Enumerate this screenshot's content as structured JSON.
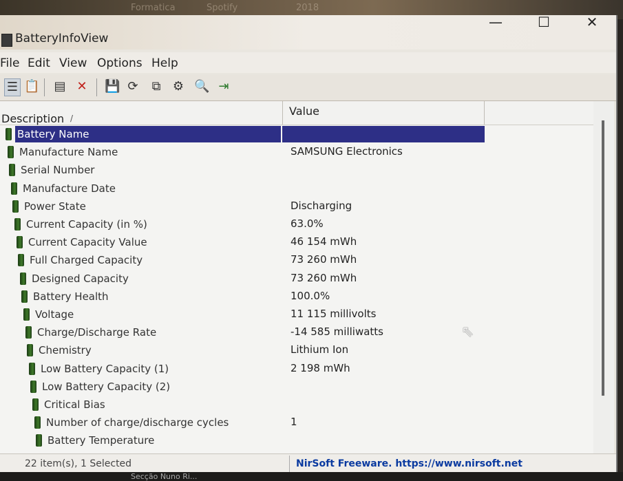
{
  "background": {
    "top_text": [
      "Formatica",
      "Spotify",
      "2018"
    ],
    "bottom_text": "Secção Nuno Ri..."
  },
  "window": {
    "title": "BatteryInfoView",
    "minimize": "—",
    "maximize": "☐",
    "close": "✕"
  },
  "menu": [
    "File",
    "Edit",
    "View",
    "Options",
    "Help"
  ],
  "toolbar": {
    "icons": [
      "properties-icon",
      "clipboard-icon",
      "html-report-icon",
      "delete-icon",
      "save-icon",
      "refresh-icon",
      "copy-icon",
      "options-icon",
      "find-icon",
      "exit-icon"
    ]
  },
  "table": {
    "col_description": "Description",
    "col_value": "Value",
    "sort_indicator": "/",
    "rows": [
      {
        "description": "Battery Name",
        "value": "",
        "selected": true
      },
      {
        "description": "Manufacture Name",
        "value": "SAMSUNG Electronics"
      },
      {
        "description": "Serial Number",
        "value": ""
      },
      {
        "description": "Manufacture Date",
        "value": ""
      },
      {
        "description": "Power State",
        "value": "Discharging"
      },
      {
        "description": "Current Capacity (in %)",
        "value": "63.0%"
      },
      {
        "description": "Current Capacity Value",
        "value": "46 154 mWh"
      },
      {
        "description": "Full Charged Capacity",
        "value": "73 260 mWh"
      },
      {
        "description": "Designed Capacity",
        "value": "73 260 mWh"
      },
      {
        "description": "Battery Health",
        "value": "100.0%"
      },
      {
        "description": "Voltage",
        "value": "11 115 millivolts"
      },
      {
        "description": "Charge/Discharge Rate",
        "value": "-14 585 milliwatts"
      },
      {
        "description": "Chemistry",
        "value": "Lithium Ion"
      },
      {
        "description": "Low Battery Capacity (1)",
        "value": "2 198 mWh"
      },
      {
        "description": "Low Battery Capacity (2)",
        "value": ""
      },
      {
        "description": "Critical Bias",
        "value": ""
      },
      {
        "description": "Number of charge/discharge cycles",
        "value": "1"
      },
      {
        "description": "Battery Temperature",
        "value": ""
      }
    ]
  },
  "status": {
    "count": "22 item(s), 1 Selected",
    "link": "NirSoft Freeware. https://www.nirsoft.net"
  }
}
